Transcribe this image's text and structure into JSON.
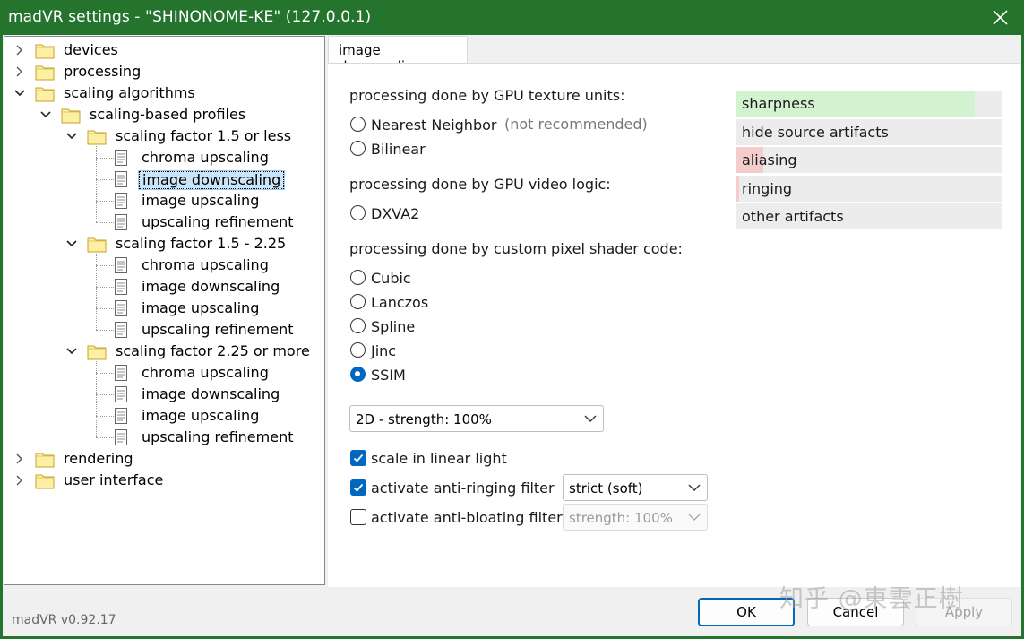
{
  "window": {
    "title": "madVR settings - \"SHINONOME-KE\" (127.0.0.1)"
  },
  "tree": {
    "devices": "devices",
    "processing": "processing",
    "scaling_algorithms": "scaling algorithms",
    "scaling_based_profiles": "scaling-based profiles",
    "groups": [
      {
        "label": "scaling factor 1.5 or less",
        "items": [
          "chroma upscaling",
          "image downscaling",
          "image upscaling",
          "upscaling refinement"
        ]
      },
      {
        "label": "scaling factor 1.5 - 2.25",
        "items": [
          "chroma upscaling",
          "image downscaling",
          "image upscaling",
          "upscaling refinement"
        ]
      },
      {
        "label": "scaling factor 2.25 or more",
        "items": [
          "chroma upscaling",
          "image downscaling",
          "image upscaling",
          "upscaling refinement"
        ]
      }
    ],
    "rendering": "rendering",
    "user_interface": "user interface",
    "selected": "scaling factor 1.5 or less / image downscaling"
  },
  "tab": {
    "label": "image downscaling"
  },
  "sections": {
    "gpu_texture": "processing done by GPU texture units:",
    "gpu_video": "processing done by GPU video logic:",
    "pixel_shader": "processing done by custom pixel shader code:"
  },
  "radios": {
    "nearest": "Nearest Neighbor",
    "nearest_note": "(not recommended)",
    "bilinear": "Bilinear",
    "dxva2": "DXVA2",
    "cubic": "Cubic",
    "lanczos": "Lanczos",
    "spline": "Spline",
    "jinc": "Jinc",
    "ssim": "SSIM",
    "selected": "SSIM"
  },
  "ssim_select": {
    "value": "2D - strength: 100%"
  },
  "options": {
    "linear_light": {
      "label": "scale in linear light",
      "checked": true
    },
    "anti_ringing": {
      "label": "activate anti-ringing filter",
      "checked": true,
      "select": "strict (soft)"
    },
    "anti_bloating": {
      "label": "activate anti-bloating filter",
      "checked": false,
      "select": "strength: 100%"
    }
  },
  "quality_meters": [
    {
      "label": "sharpness",
      "level": 0.9,
      "color": "#d3f2d0"
    },
    {
      "label": "hide source artifacts",
      "level": 0.0,
      "color": "#ececec"
    },
    {
      "label": "aliasing",
      "level": 0.1,
      "color": "#f4cccc"
    },
    {
      "label": "ringing",
      "level": 0.01,
      "color": "#f4cccc"
    },
    {
      "label": "other artifacts",
      "level": 0.0,
      "color": "#ececec"
    }
  ],
  "footer": {
    "version": "madVR v0.92.17",
    "ok": "OK",
    "cancel": "Cancel",
    "apply": "Apply",
    "watermark": "知乎 @東雲正樹"
  },
  "colors": {
    "titlebar": "#24742e",
    "accent": "#0067c0"
  }
}
